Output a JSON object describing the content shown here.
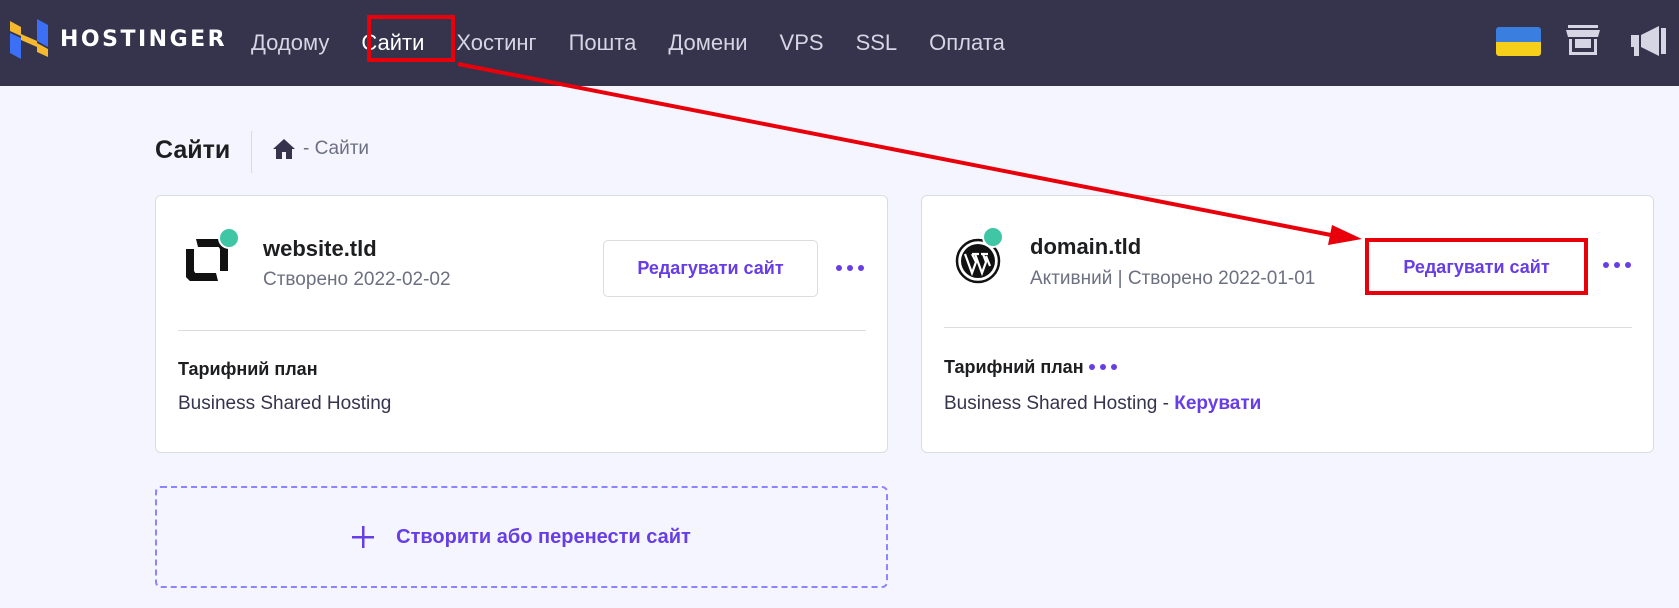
{
  "brand": {
    "name": "HOSTINGER"
  },
  "nav": {
    "items": [
      {
        "label": "Додому",
        "active": false
      },
      {
        "label": "Сайти",
        "active": true
      },
      {
        "label": "Хостинг",
        "active": false
      },
      {
        "label": "Пошта",
        "active": false
      },
      {
        "label": "Домени",
        "active": false
      },
      {
        "label": "VPS",
        "active": false
      },
      {
        "label": "SSL",
        "active": false
      },
      {
        "label": "Оплата",
        "active": false
      }
    ]
  },
  "header_icons": [
    "ukraine-flag-icon",
    "store-icon",
    "megaphone-icon"
  ],
  "page": {
    "title": "Сайти",
    "breadcrumb": "- Сайти"
  },
  "sites": [
    {
      "name": "website.tld",
      "meta": "Створено 2022-02-02",
      "edit_label": "Редагувати сайт",
      "plan_label": "Тарифний план",
      "plan_value": "Business Shared Hosting",
      "icon": "custom-site-logo-icon"
    },
    {
      "name": "domain.tld",
      "meta": "Активний | Створено 2022-01-01",
      "edit_label": "Редагувати сайт",
      "plan_label": "Тарифний план",
      "plan_value": "Business Shared Hosting - ",
      "manage_label": "Керувати",
      "icon": "wordpress-icon"
    }
  ],
  "create": {
    "label": "Створити або перенести сайт"
  },
  "colors": {
    "header_bg": "#36344d",
    "accent": "#673de6",
    "status_active": "#3fc6a4",
    "annotation": "#e8000b"
  }
}
